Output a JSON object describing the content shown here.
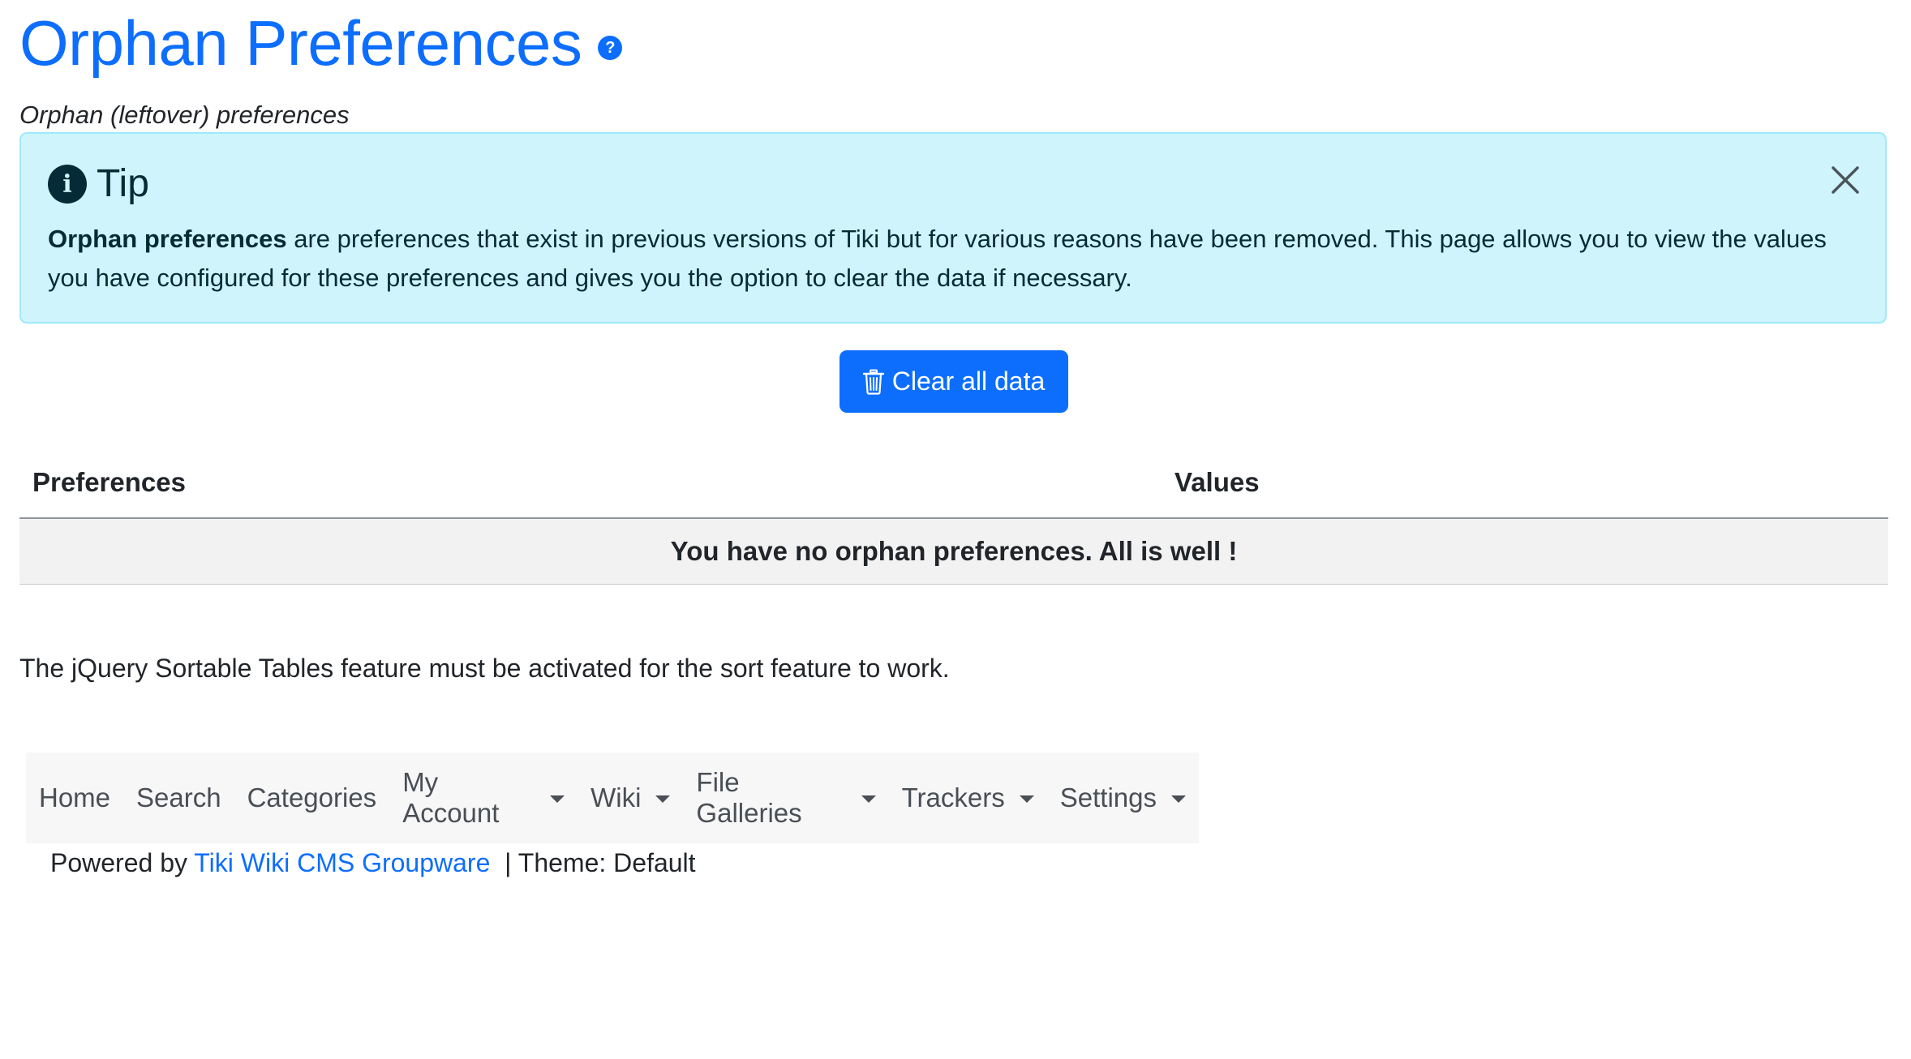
{
  "header": {
    "title": "Orphan Preferences",
    "help_icon_glyph": "?",
    "subtitle": "Orphan (leftover) preferences"
  },
  "tip": {
    "title": "Tip",
    "info_icon_glyph": "i",
    "bold_text": "Orphan preferences",
    "body_text": " are preferences that exist in previous versions of Tiki but for various reasons have been removed. This page allows you to view the values you have configured for these preferences and gives you the option to clear the data if necessary."
  },
  "actions": {
    "clear_label": "Clear all data"
  },
  "table": {
    "columns": [
      "Preferences",
      "Values"
    ],
    "empty_message": "You have no orphan preferences. All is well !"
  },
  "note": "The jQuery Sortable Tables feature must be activated for the sort feature to work.",
  "nav": {
    "items": [
      {
        "label": "Home",
        "dropdown": false
      },
      {
        "label": "Search",
        "dropdown": false
      },
      {
        "label": "Categories",
        "dropdown": false
      },
      {
        "label": "My Account",
        "dropdown": true
      },
      {
        "label": "Wiki",
        "dropdown": true
      },
      {
        "label": "File Galleries",
        "dropdown": true
      },
      {
        "label": "Trackers",
        "dropdown": true
      },
      {
        "label": "Settings",
        "dropdown": true
      }
    ]
  },
  "footer": {
    "powered_by": "Powered by",
    "link_text": "Tiki Wiki CMS Groupware",
    "theme_text": "| Theme: Default"
  },
  "colors": {
    "primary": "#0d6efd",
    "tip_background": "#cff4fc",
    "tip_text": "#052c36"
  },
  "icons": {
    "help": "question-circle-icon",
    "info": "info-circle-icon",
    "close": "close-icon",
    "trash": "trash-icon",
    "caret": "caret-down-icon"
  }
}
